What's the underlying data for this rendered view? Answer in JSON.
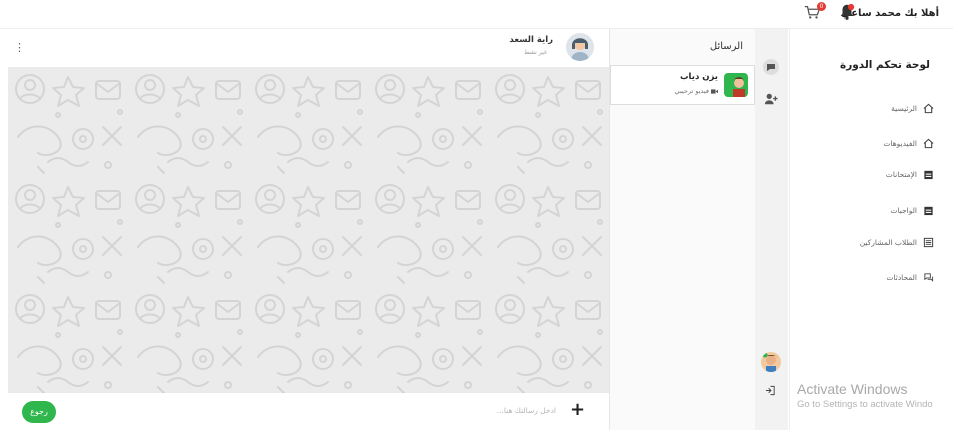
{
  "topbar": {
    "user_greeting": "أهلا بك محمد ساعي",
    "cart_count": "0",
    "bell_icon": "bell-icon",
    "cart_icon": "cart-icon"
  },
  "sidebar": {
    "title": "لوحة تحكم الدورة",
    "items": [
      {
        "label": "الرئيسية",
        "icon": "home-icon"
      },
      {
        "label": "الفيديوهات",
        "icon": "home-icon"
      },
      {
        "label": "الإمتحانات",
        "icon": "calendar-icon"
      },
      {
        "label": "الواجبات",
        "icon": "calendar-icon"
      },
      {
        "label": "الطلاب المشاركين",
        "icon": "list-icon"
      },
      {
        "label": "المحادثات",
        "icon": "chat-icon"
      }
    ]
  },
  "strip": {
    "icons": [
      "chat-bubble-icon",
      "add-user-icon",
      "avatar",
      "logout-icon"
    ]
  },
  "conversations": {
    "title": "الرسائل",
    "items": [
      {
        "name": "يزن دياب",
        "preview": "فيديو ترحيبي",
        "preview_icon": "video-icon"
      }
    ]
  },
  "chat": {
    "contact_name": "راية السعد",
    "contact_status": "غير نشط",
    "menu_icon": "kebab-menu-icon"
  },
  "composer": {
    "placeholder": "ادخل رسالتك هنا...",
    "add_label": "+",
    "back_label": "رجوع"
  },
  "watermark": {
    "title": "Activate Windows",
    "subtitle": "Go to Settings to activate Windo"
  },
  "colors": {
    "accent_green": "#2fb64c",
    "badge_red": "#e53935",
    "chat_bg": "#e9e9e9"
  }
}
